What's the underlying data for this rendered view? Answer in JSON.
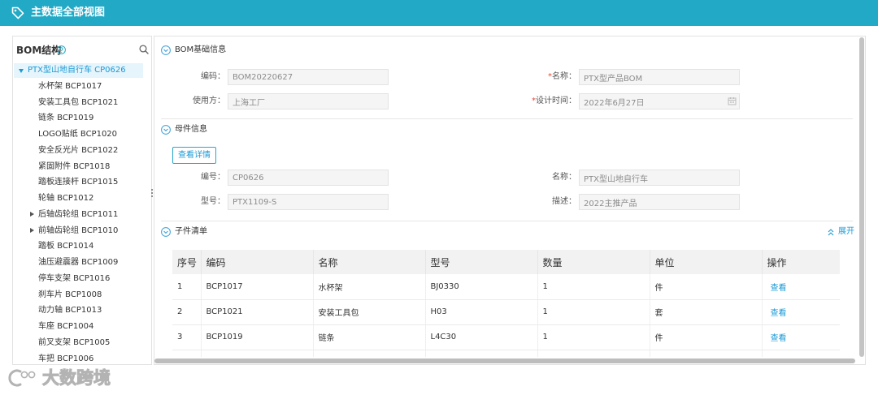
{
  "header": {
    "title": "主数据全部视图",
    "icon": "tag-icon"
  },
  "tree": {
    "title": "BOM结构",
    "help_icon": "question-circle-icon",
    "search_icon": "search-icon",
    "root": {
      "label": "PTX型山地自行车 CP0626",
      "expanded": true,
      "selected": true
    },
    "children": [
      {
        "label": "水杯架 BCP1017",
        "expandable": false
      },
      {
        "label": "安装工具包 BCP1021",
        "expandable": false
      },
      {
        "label": "链条 BCP1019",
        "expandable": false
      },
      {
        "label": "LOGO贴纸 BCP1020",
        "expandable": false
      },
      {
        "label": "安全反光片 BCP1022",
        "expandable": false
      },
      {
        "label": "紧固附件 BCP1018",
        "expandable": false
      },
      {
        "label": "踏板连接杆 BCP1015",
        "expandable": false
      },
      {
        "label": "轮轴 BCP1012",
        "expandable": false
      },
      {
        "label": "后轴齿轮组 BCP1011",
        "expandable": true
      },
      {
        "label": "前轴齿轮组 BCP1010",
        "expandable": true
      },
      {
        "label": "踏板 BCP1014",
        "expandable": false
      },
      {
        "label": "油压避震器 BCP1009",
        "expandable": false
      },
      {
        "label": "停车支架 BCP1016",
        "expandable": false
      },
      {
        "label": "刹车片 BCP1008",
        "expandable": false
      },
      {
        "label": "动力轴 BCP1013",
        "expandable": false
      },
      {
        "label": "车座 BCP1004",
        "expandable": false
      },
      {
        "label": "前叉支架 BCP1005",
        "expandable": false
      },
      {
        "label": "车把 BCP1006",
        "expandable": false
      }
    ]
  },
  "required_mark": "*",
  "bom_info": {
    "title": "BOM基础信息",
    "icon": "chevron-circle-down-icon",
    "code": {
      "label": "编码：",
      "value": "BOM20220627"
    },
    "name": {
      "label": "名称：",
      "value": "PTX型产品BOM",
      "required": true
    },
    "user": {
      "label": "使用方：",
      "value": "上海工厂"
    },
    "design_time": {
      "label": "设计时间：",
      "value": "2022年6月27日",
      "required": true,
      "icon": "calendar-icon"
    }
  },
  "parent_info": {
    "title": "母件信息",
    "icon": "chevron-circle-down-icon",
    "detail_button": "查看详情",
    "number": {
      "label": "编号：",
      "value": "CP0626"
    },
    "name": {
      "label": "名称：",
      "value": "PTX型山地自行车"
    },
    "model": {
      "label": "型号：",
      "value": "PTX1109-S"
    },
    "description": {
      "label": "描述：",
      "value": "2022主推产品"
    }
  },
  "child_list": {
    "title": "子件清单",
    "icon": "chevron-circle-down-icon",
    "expand_label": "展开",
    "expand_icon": "double-chevron-up-icon",
    "columns": [
      "序号",
      "编码",
      "名称",
      "型号",
      "数量",
      "单位",
      "操作"
    ],
    "rows": [
      {
        "index": "1",
        "code": "BCP1017",
        "name": "水杯架",
        "model": "BJ0330",
        "qty": "1",
        "unit": "件",
        "action": "查看"
      },
      {
        "index": "2",
        "code": "BCP1021",
        "name": "安装工具包",
        "model": "H03",
        "qty": "1",
        "unit": "套",
        "action": "查看"
      },
      {
        "index": "3",
        "code": "BCP1019",
        "name": "链条",
        "model": "L4C30",
        "qty": "1",
        "unit": "件",
        "action": "查看"
      }
    ]
  },
  "watermark": {
    "text": "大数跨境",
    "icon": "brand-logo-icon"
  },
  "colors": {
    "brand": "#22a9c6",
    "link": "#1a9ad6",
    "required": "#e5483b",
    "selected_bg": "#e6f4fb",
    "input_bg": "#f5f5f5",
    "table_header_bg": "#f2f2f2"
  }
}
